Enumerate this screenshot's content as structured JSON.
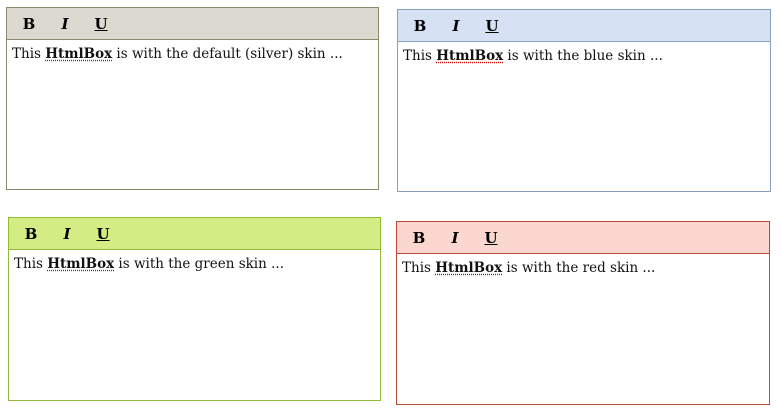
{
  "toolbar_buttons": {
    "bold": "B",
    "italic": "I",
    "underline": "U"
  },
  "editors": [
    {
      "skin": "silver",
      "text_before": "This ",
      "highlight": "HtmlBox",
      "text_after": " is with the default (silver) skin ...",
      "toolbar_color": "#dcdad0",
      "border_color": "#8a8a6a"
    },
    {
      "skin": "blue",
      "text_before": "This ",
      "highlight": "HtmlBox",
      "text_after": " is with the blue skin ...",
      "toolbar_color": "#d6e2f3",
      "border_color": "#8aa0c0"
    },
    {
      "skin": "green",
      "text_before": "This ",
      "highlight": "HtmlBox",
      "text_after": " is with the green skin ...",
      "toolbar_color": "#d4ec84",
      "border_color": "#94b83a"
    },
    {
      "skin": "red",
      "text_before": "This ",
      "highlight": "HtmlBox",
      "text_after": " is with the red skin ...",
      "toolbar_color": "#fbd7cf",
      "border_color": "#b84a3a"
    }
  ]
}
